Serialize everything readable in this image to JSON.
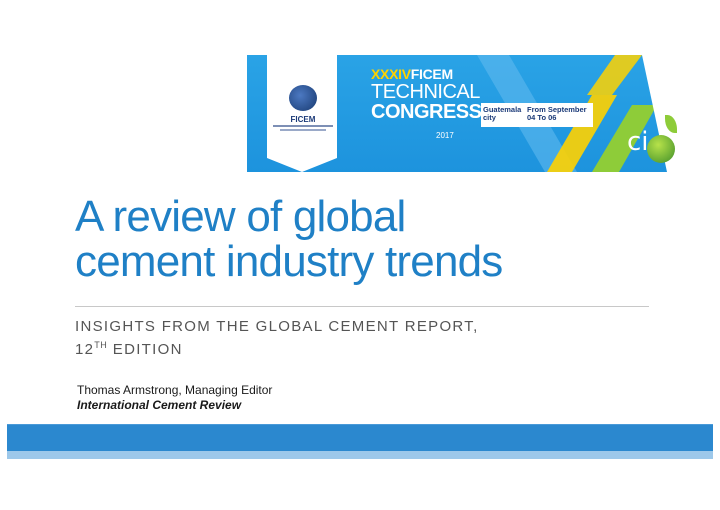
{
  "banner": {
    "edition_number": "XXXIV",
    "edition_org": "FICEM",
    "line_technical": "TECHNICAL",
    "line_congress": "CONGRESS",
    "year": "2017",
    "city": "Guatemala city",
    "dates": "From September 04 To 06",
    "logo_text": "FICEM",
    "cio_text": "ci",
    "colors": {
      "primary_blue": "#1d93dd",
      "yellow": "#ffd200",
      "green": "#8ecc39"
    }
  },
  "slide": {
    "title_line1": "A review of global",
    "title_line2": "cement industry trends",
    "subtitle_line1": "INSIGHTS FROM THE GLOBAL CEMENT REPORT,",
    "subtitle_num": "12",
    "subtitle_sup": "TH",
    "subtitle_end": " EDITION",
    "author": "Thomas Armstrong, Managing Editor",
    "organization": "International Cement Review",
    "colors": {
      "title": "#1f80c6",
      "footer": "#2b88cf"
    }
  }
}
